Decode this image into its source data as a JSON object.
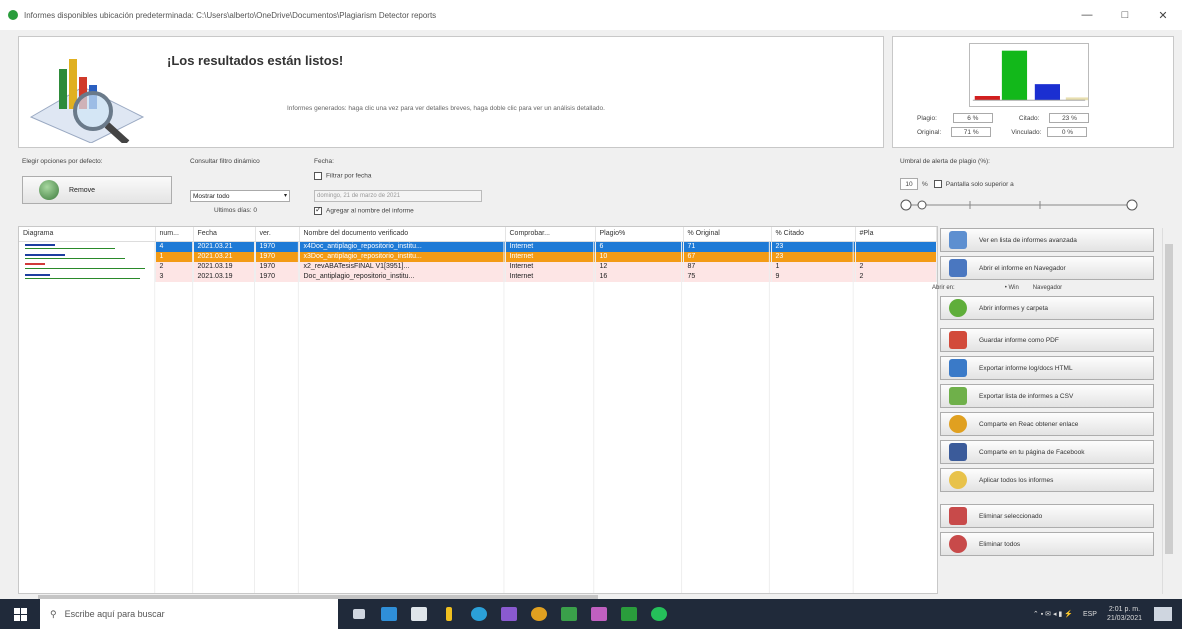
{
  "window": {
    "title": "Informes disponibles ubicación predeterminada: C:\\Users\\alberto\\OneDrive\\Documentos\\Plagiarism Detector reports",
    "controls": [
      "—",
      "□",
      "✕"
    ]
  },
  "header": {
    "title": "¡Los resultados están listos!",
    "note": "Informes generados: haga clic una vez para ver detalles breves, haga doble clic para ver un análisis detallado."
  },
  "stats": {
    "rows": [
      {
        "label": "Plagio:",
        "value": "6 %",
        "label2": "Citado:",
        "value2": "23 %"
      },
      {
        "label": "Original:",
        "value": "71 %",
        "label2": "Vinculado:",
        "value2": "0 %"
      }
    ],
    "chart_bars": [
      {
        "color": "#d21f1f",
        "value": 6
      },
      {
        "color": "#12b81a",
        "value": 71
      },
      {
        "color": "#1b2fd1",
        "value": 23
      },
      {
        "color": "#e8dfb0",
        "value": 4
      }
    ]
  },
  "options": {
    "default_label": "Elegir opciones por defecto:",
    "remove_button": "Remove",
    "filter_label": "Consultar filtro dinámico",
    "select_value": "Mostrar todo",
    "days_label": "Ultimos días: 0",
    "date_label": "Fecha:",
    "filter_by_date": "Filtrar por fecha",
    "date_value": "domingo, 21 de marzo de 2021",
    "add_name": "Agregar al nombre del informe",
    "threshold_label": "Umbral de alerta de plagio (%):",
    "threshold_value": "10",
    "threshold_check": "Pantalla solo superior a"
  },
  "table": {
    "columns": [
      "Diagrama",
      "num...",
      "Fecha",
      "ver.",
      "Nombre del documento verificado",
      "Comprobar...",
      "Plagio%",
      "% Original",
      "% Citado",
      "#Pla"
    ],
    "rows": [
      {
        "num": "4",
        "date": "2021.03.21",
        "ver": "1970",
        "name": "x4Doc_antiplagio_repositorio_institu...",
        "check": "Internet",
        "plag": "6",
        "orig": "71",
        "cited": "23",
        "extra": "",
        "style": "sel-blue"
      },
      {
        "num": "1",
        "date": "2021.03.21",
        "ver": "1970",
        "name": "x3Doc_antiplagio_repositorio_institu...",
        "check": "Internet",
        "plag": "10",
        "orig": "67",
        "cited": "23",
        "extra": "",
        "style": "sel-orange"
      },
      {
        "num": "2",
        "date": "2021.03.19",
        "ver": "1970",
        "name": "x2_revABATesisFINAL V1[3951]...",
        "check": "Internet",
        "plag": "12",
        "orig": "87",
        "cited": "1",
        "extra": "2",
        "style": "pink"
      },
      {
        "num": "3",
        "date": "2021.03.19",
        "ver": "1970",
        "name": "Doc_antiplagio_repositorio_institu...",
        "check": "Internet",
        "plag": "16",
        "orig": "75",
        "cited": "9",
        "extra": "2",
        "style": "pink"
      }
    ]
  },
  "actions": {
    "buttons": [
      {
        "label": "Ver en lista de informes avanzada",
        "color": "#5d8fd0"
      },
      {
        "label": "Abrir el informe en Navegador",
        "color": "#4a77c0"
      },
      {
        "label": "Abrir informes y carpeta",
        "color": "#5fae3a"
      },
      {
        "label": "Guardar informe como PDF",
        "color": "#d24a3a"
      },
      {
        "label": "Exportar informe log/docs HTML",
        "color": "#3a7ac8"
      },
      {
        "label": "Exportar lista de informes a CSV",
        "color": "#6fb04a"
      },
      {
        "label": "Comparte en Reac obtener enlace",
        "color": "#e0a020"
      },
      {
        "label": "Comparte en tu página de Facebook",
        "color": "#3b5b9a"
      },
      {
        "label": "Aplicar todos los informes",
        "color": "#e8c24a"
      },
      {
        "label": "Eliminar seleccionado",
        "color": "#c84a4a"
      },
      {
        "label": "Eliminar todos",
        "color": "#c84a4a"
      }
    ],
    "open_in_label": "Abrir en:",
    "radio1": "• Win",
    "radio2": "Navegador"
  },
  "taskbar": {
    "search_placeholder": "Escribe aquí para buscar",
    "time": "2:01 p. m.",
    "date": "21/03/2021",
    "lang": "ESP"
  }
}
